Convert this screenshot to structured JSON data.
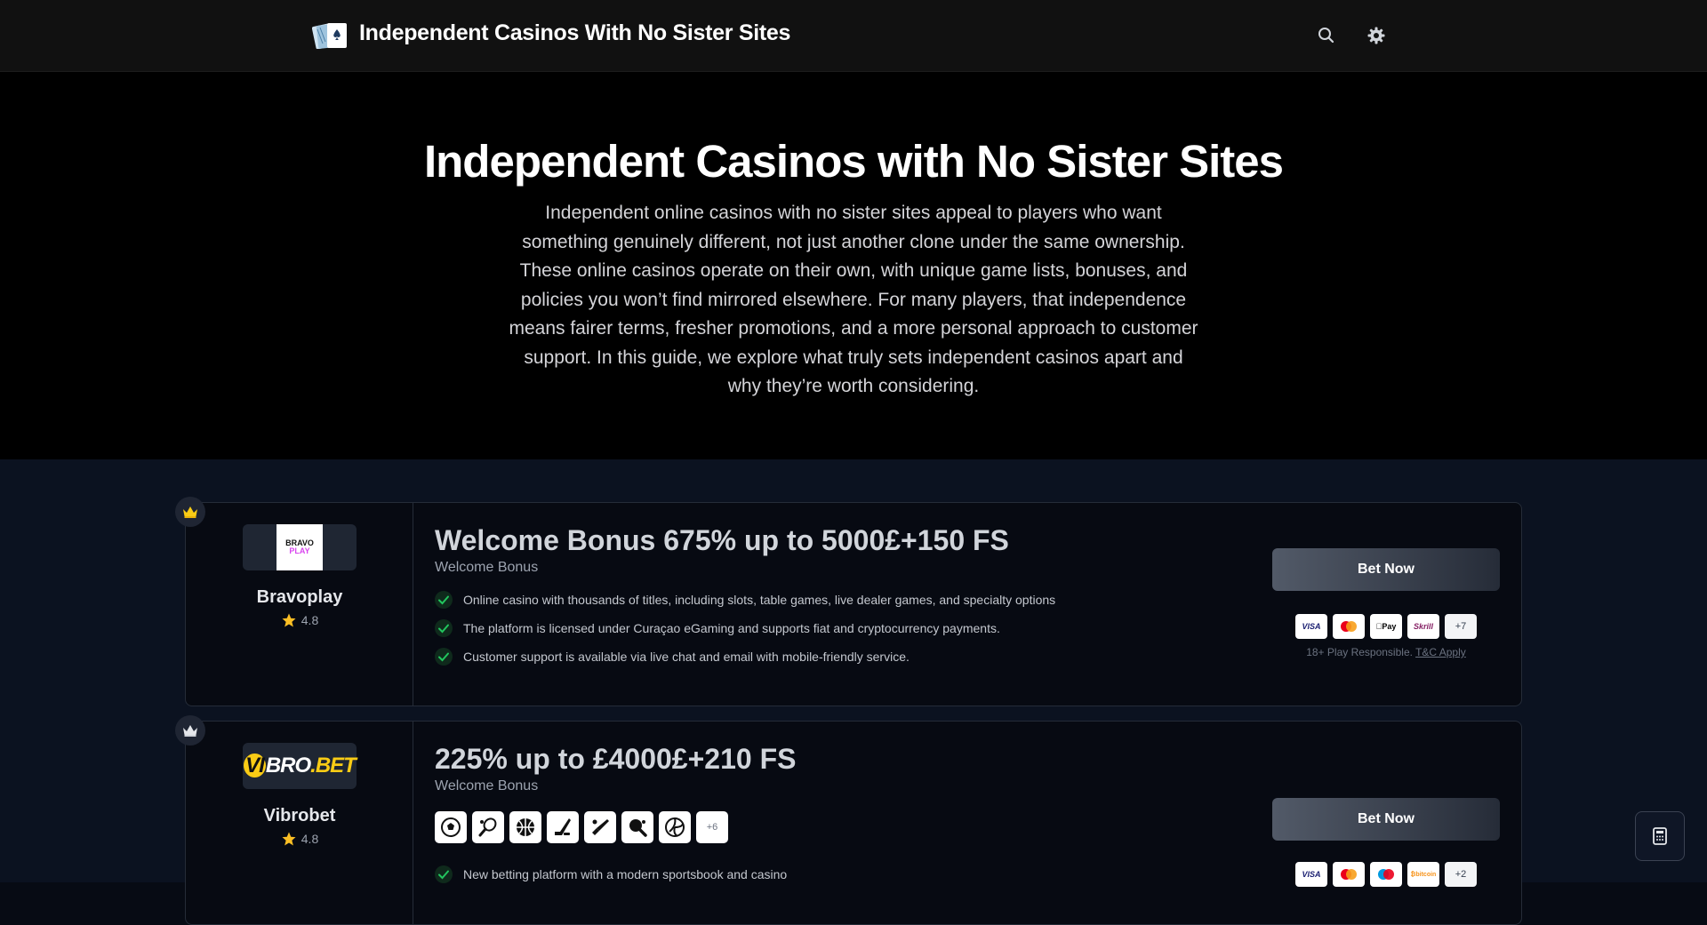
{
  "header": {
    "site_title": "Independent Casinos With No Sister Sites",
    "search_icon": "search-icon",
    "theme_icon": "gear-icon"
  },
  "hero": {
    "title": "Independent Casinos with No Sister Sites",
    "text": "Independent online casinos with no sister sites appeal to players who want something genuinely different, not just another clone under the same ownership. These online casinos operate on their own, with unique game lists, bonuses, and policies you won’t find mirrored elsewhere. For many players, that independence means fairer terms, fresher promotions, and a more personal approach to customer support. In this guide, we explore what truly sets independent casinos apart and why they’re worth considering."
  },
  "casinos": [
    {
      "logo_text": "BRAVO PLAY",
      "name": "Bravoplay",
      "rating": "4.8",
      "offer_title": "Welcome Bonus 675% up to 5000£+150 FS",
      "offer_sub": "Welcome Bonus",
      "features": [
        "Online casino with thousands of titles, including slots, table games, live dealer games, and specialty options",
        "The platform is licensed under Curaçao eGaming and supports fiat and cryptocurrency payments.",
        "Customer support is available via live chat and email with mobile-friendly service."
      ],
      "bet_label": "Bet Now",
      "payments": [
        "VISA",
        "Mastercard",
        "Apple Pay",
        "Skrill"
      ],
      "payments_more": "+7",
      "responsible": "18+ Play Responsible.",
      "tc_label": "T&C Apply"
    },
    {
      "logo_text": "VIBRO.BET",
      "name": "Vibrobet",
      "rating": "4.8",
      "offer_title": "225% up to £4000£+210 FS",
      "offer_sub": "Welcome Bonus",
      "sports": [
        "soccer-icon",
        "tennis-icon",
        "basketball-icon",
        "hockey-icon",
        "cricket-icon",
        "table-tennis-icon",
        "volleyball-icon"
      ],
      "sports_more": "+6",
      "features": [
        "New betting platform with a modern sportsbook and casino"
      ],
      "bet_label": "Bet Now",
      "payments": [
        "VISA",
        "Mastercard",
        "Maestro",
        "bitcoin"
      ],
      "payments_more": "+2"
    }
  ],
  "calculator_icon": "calculator-icon"
}
